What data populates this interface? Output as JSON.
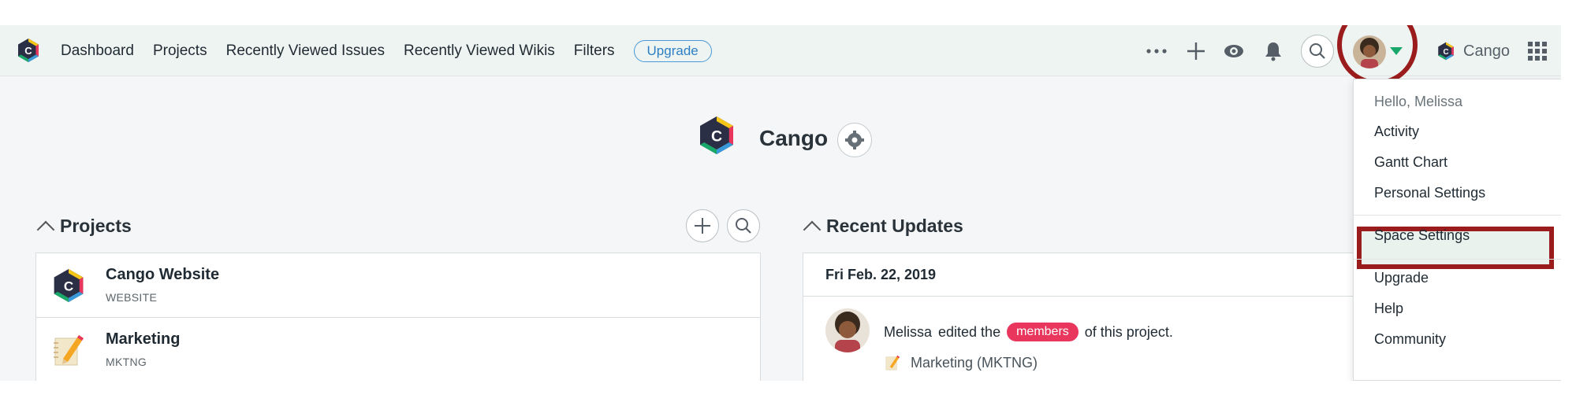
{
  "nav": {
    "links": [
      "Dashboard",
      "Projects",
      "Recently Viewed Issues",
      "Recently Viewed Wikis",
      "Filters"
    ],
    "upgrade_label": "Upgrade",
    "brand_label": "Cango",
    "icons": [
      "more-icon",
      "plus-icon",
      "eye-icon",
      "bell-icon",
      "search-icon",
      "user-avatar",
      "caret-down-icon",
      "app-grid-icon"
    ]
  },
  "workspace": {
    "title": "Cango"
  },
  "projects": {
    "heading": "Projects",
    "items": [
      {
        "name": "Cango Website",
        "key": "WEBSITE",
        "icon": "cango-logo"
      },
      {
        "name": "Marketing",
        "key": "MKTNG",
        "icon": "pencil-notepad"
      }
    ]
  },
  "recent": {
    "heading": "Recent Updates",
    "date": "Fri Feb. 22, 2019",
    "update": {
      "user": "Melissa",
      "action": "edited the",
      "badge": "members",
      "suffix": "of this project.",
      "project": "Marketing (MKTNG)"
    }
  },
  "user_menu": {
    "hello": "Hello, Melissa",
    "items_top": [
      "Activity",
      "Gantt Chart",
      "Personal Settings"
    ],
    "highlighted": "Space Settings",
    "items_bottom": [
      "Upgrade",
      "Help",
      "Community"
    ]
  },
  "colors": {
    "topbar_bg": "#eef4f1",
    "accent_green": "#1aa86a",
    "upgrade_blue": "#2d7fc4",
    "badge_red": "#e8365d",
    "annotation_red": "#9b1c1c"
  }
}
